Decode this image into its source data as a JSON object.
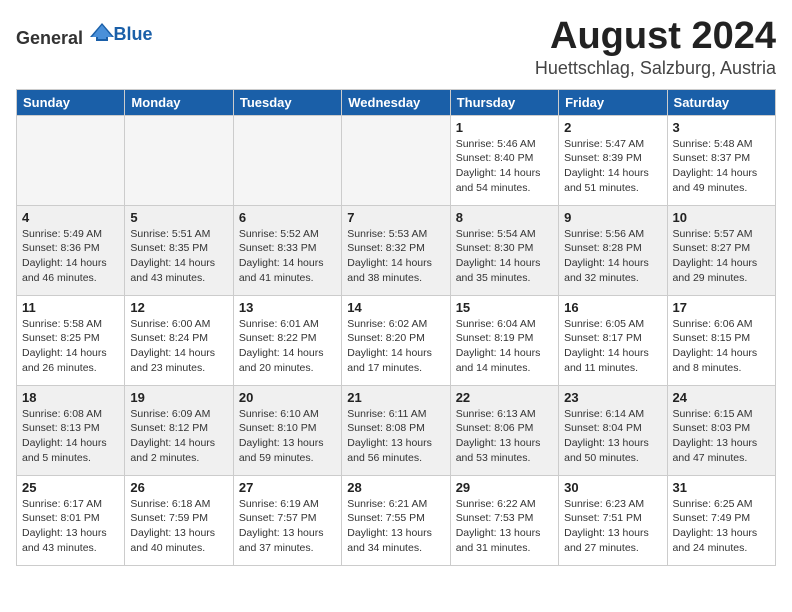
{
  "header": {
    "logo_general": "General",
    "logo_blue": "Blue",
    "month": "August 2024",
    "location": "Huettschlag, Salzburg, Austria"
  },
  "weekdays": [
    "Sunday",
    "Monday",
    "Tuesday",
    "Wednesday",
    "Thursday",
    "Friday",
    "Saturday"
  ],
  "weeks": [
    [
      {
        "day": "",
        "info": ""
      },
      {
        "day": "",
        "info": ""
      },
      {
        "day": "",
        "info": ""
      },
      {
        "day": "",
        "info": ""
      },
      {
        "day": "1",
        "info": "Sunrise: 5:46 AM\nSunset: 8:40 PM\nDaylight: 14 hours\nand 54 minutes."
      },
      {
        "day": "2",
        "info": "Sunrise: 5:47 AM\nSunset: 8:39 PM\nDaylight: 14 hours\nand 51 minutes."
      },
      {
        "day": "3",
        "info": "Sunrise: 5:48 AM\nSunset: 8:37 PM\nDaylight: 14 hours\nand 49 minutes."
      }
    ],
    [
      {
        "day": "4",
        "info": "Sunrise: 5:49 AM\nSunset: 8:36 PM\nDaylight: 14 hours\nand 46 minutes."
      },
      {
        "day": "5",
        "info": "Sunrise: 5:51 AM\nSunset: 8:35 PM\nDaylight: 14 hours\nand 43 minutes."
      },
      {
        "day": "6",
        "info": "Sunrise: 5:52 AM\nSunset: 8:33 PM\nDaylight: 14 hours\nand 41 minutes."
      },
      {
        "day": "7",
        "info": "Sunrise: 5:53 AM\nSunset: 8:32 PM\nDaylight: 14 hours\nand 38 minutes."
      },
      {
        "day": "8",
        "info": "Sunrise: 5:54 AM\nSunset: 8:30 PM\nDaylight: 14 hours\nand 35 minutes."
      },
      {
        "day": "9",
        "info": "Sunrise: 5:56 AM\nSunset: 8:28 PM\nDaylight: 14 hours\nand 32 minutes."
      },
      {
        "day": "10",
        "info": "Sunrise: 5:57 AM\nSunset: 8:27 PM\nDaylight: 14 hours\nand 29 minutes."
      }
    ],
    [
      {
        "day": "11",
        "info": "Sunrise: 5:58 AM\nSunset: 8:25 PM\nDaylight: 14 hours\nand 26 minutes."
      },
      {
        "day": "12",
        "info": "Sunrise: 6:00 AM\nSunset: 8:24 PM\nDaylight: 14 hours\nand 23 minutes."
      },
      {
        "day": "13",
        "info": "Sunrise: 6:01 AM\nSunset: 8:22 PM\nDaylight: 14 hours\nand 20 minutes."
      },
      {
        "day": "14",
        "info": "Sunrise: 6:02 AM\nSunset: 8:20 PM\nDaylight: 14 hours\nand 17 minutes."
      },
      {
        "day": "15",
        "info": "Sunrise: 6:04 AM\nSunset: 8:19 PM\nDaylight: 14 hours\nand 14 minutes."
      },
      {
        "day": "16",
        "info": "Sunrise: 6:05 AM\nSunset: 8:17 PM\nDaylight: 14 hours\nand 11 minutes."
      },
      {
        "day": "17",
        "info": "Sunrise: 6:06 AM\nSunset: 8:15 PM\nDaylight: 14 hours\nand 8 minutes."
      }
    ],
    [
      {
        "day": "18",
        "info": "Sunrise: 6:08 AM\nSunset: 8:13 PM\nDaylight: 14 hours\nand 5 minutes."
      },
      {
        "day": "19",
        "info": "Sunrise: 6:09 AM\nSunset: 8:12 PM\nDaylight: 14 hours\nand 2 minutes."
      },
      {
        "day": "20",
        "info": "Sunrise: 6:10 AM\nSunset: 8:10 PM\nDaylight: 13 hours\nand 59 minutes."
      },
      {
        "day": "21",
        "info": "Sunrise: 6:11 AM\nSunset: 8:08 PM\nDaylight: 13 hours\nand 56 minutes."
      },
      {
        "day": "22",
        "info": "Sunrise: 6:13 AM\nSunset: 8:06 PM\nDaylight: 13 hours\nand 53 minutes."
      },
      {
        "day": "23",
        "info": "Sunrise: 6:14 AM\nSunset: 8:04 PM\nDaylight: 13 hours\nand 50 minutes."
      },
      {
        "day": "24",
        "info": "Sunrise: 6:15 AM\nSunset: 8:03 PM\nDaylight: 13 hours\nand 47 minutes."
      }
    ],
    [
      {
        "day": "25",
        "info": "Sunrise: 6:17 AM\nSunset: 8:01 PM\nDaylight: 13 hours\nand 43 minutes."
      },
      {
        "day": "26",
        "info": "Sunrise: 6:18 AM\nSunset: 7:59 PM\nDaylight: 13 hours\nand 40 minutes."
      },
      {
        "day": "27",
        "info": "Sunrise: 6:19 AM\nSunset: 7:57 PM\nDaylight: 13 hours\nand 37 minutes."
      },
      {
        "day": "28",
        "info": "Sunrise: 6:21 AM\nSunset: 7:55 PM\nDaylight: 13 hours\nand 34 minutes."
      },
      {
        "day": "29",
        "info": "Sunrise: 6:22 AM\nSunset: 7:53 PM\nDaylight: 13 hours\nand 31 minutes."
      },
      {
        "day": "30",
        "info": "Sunrise: 6:23 AM\nSunset: 7:51 PM\nDaylight: 13 hours\nand 27 minutes."
      },
      {
        "day": "31",
        "info": "Sunrise: 6:25 AM\nSunset: 7:49 PM\nDaylight: 13 hours\nand 24 minutes."
      }
    ]
  ]
}
